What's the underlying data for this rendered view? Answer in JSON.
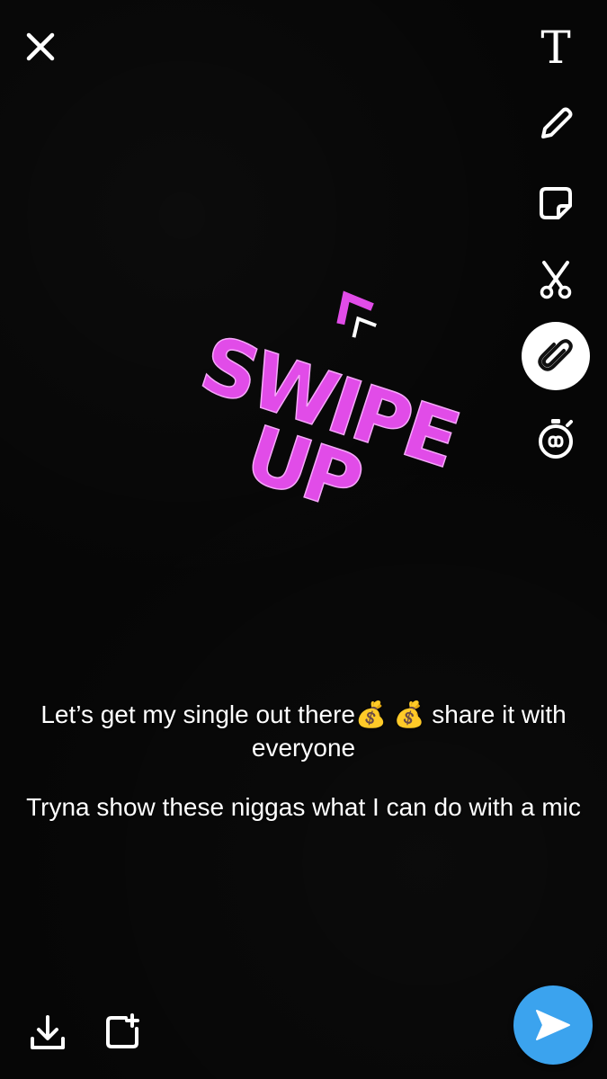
{
  "toolbar": {
    "text_tool_glyph": "T",
    "tools": [
      {
        "name": "text-tool",
        "icon": "text-icon"
      },
      {
        "name": "draw-tool",
        "icon": "pencil-icon"
      },
      {
        "name": "sticker-tool",
        "icon": "sticker-icon"
      },
      {
        "name": "scissors-tool",
        "icon": "scissors-icon"
      },
      {
        "name": "attachment-tool",
        "icon": "paperclip-icon",
        "active": true
      },
      {
        "name": "timer-tool",
        "icon": "stopwatch-icon"
      }
    ]
  },
  "sticker": {
    "line1": "SWIPE",
    "line2": "UP",
    "color": "#e14ce8"
  },
  "captions": {
    "line1": "Let’s get my single out there💰 💰  share it with everyone",
    "line2": "Tryna show these niggas what I can do with a mic"
  },
  "colors": {
    "background": "#060606",
    "send_button": "#3ba3ee",
    "sticker": "#e14ce8"
  }
}
